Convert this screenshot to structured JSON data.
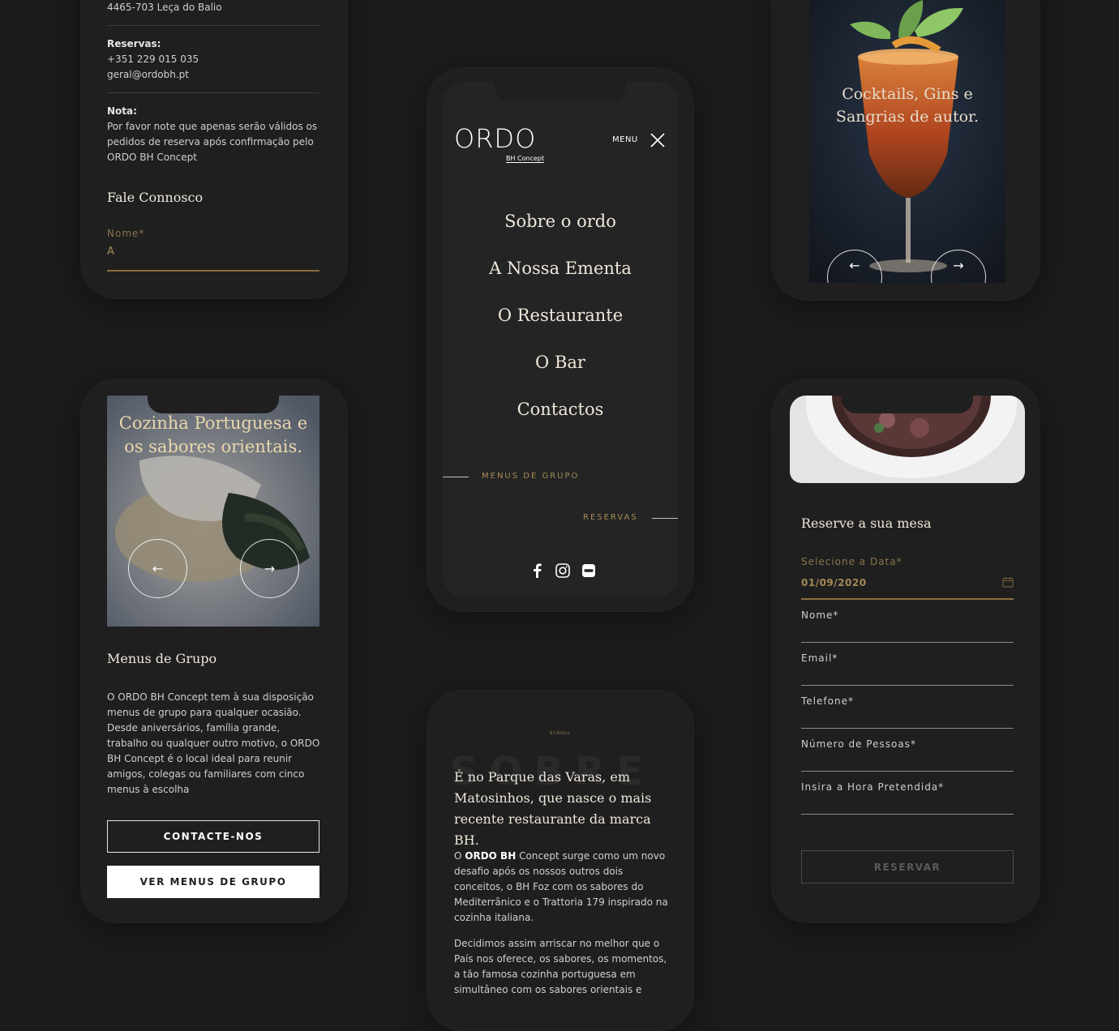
{
  "contact": {
    "address": "4465-703 Leça do Balio",
    "reservas_label": "Reservas:",
    "phone": "+351 229 015 035",
    "email": "geral@ordobh.pt",
    "nota_label": "Nota:",
    "nota_text": "Por favor note que apenas serão válidos os pedidos de reserva após confirmação pelo ORDO BH Concept",
    "form_title": "Fale Connosco",
    "name_label": "Nome*",
    "name_value": "A"
  },
  "menu_screen": {
    "logo": "ORDO",
    "logo_sub": "BH Concept",
    "menu_label": "MENU",
    "nav_items": [
      "Sobre o ordo",
      "A Nossa Ementa",
      "O Restaurante",
      "O Bar",
      "Contactos"
    ],
    "link_group": "MENUS DE GRUPO",
    "link_reservas": "RESERVAS",
    "social_icons": [
      "facebook-icon",
      "instagram-icon",
      "zomato-icon"
    ]
  },
  "cocktails": {
    "headline": "Cocktails, Gins e Sangrias de autor."
  },
  "group_menu": {
    "headline": "Cozinha Portuguesa e os sabores orientais.",
    "title": "Menus de Grupo",
    "text": "O ORDO BH Concept tem à sua disposição menus de grupo para qualquer ocasião. Desde aniversários, família grande, trabalho ou qualquer outro motivo, o ORDO BH Concept é o local ideal para reunir amigos, colegas ou familiares com cinco menus à escolha",
    "btn_contact": "CONTACTE-NOS",
    "btn_menus": "VER MENUS DE GRUPO"
  },
  "about": {
    "scroll_label": "SCROLL",
    "bg_word": "SOBRE",
    "headline": "É no Parque das Varas, em Matosinhos, que nasce o mais recente restaurante da marca BH.",
    "p1_pre": "O ",
    "p1_bold": "ORDO BH",
    "p1_post": " Concept surge como um novo desafio após os nossos outros dois conceitos, o BH Foz com os sabores do Mediterrânico e o Trattoria 179 inspirado na cozinha italiana.",
    "p2": "Decidimos assim arriscar no melhor que o País nos oferece, os sabores, os momentos, a tão famosa cozinha portuguesa em simultâneo com os sabores orientais e"
  },
  "reserve": {
    "title": "Reserve a sua mesa",
    "date_label": "Selecione a Data*",
    "date_value": "01/09/2020",
    "fields": [
      "Nome*",
      "Email*",
      "Telefone*",
      "Número de Pessoas*",
      "Insira a Hora Pretendida*"
    ],
    "submit": "RESERVAR"
  },
  "colors": {
    "background": "#1b1b1b",
    "accent_gold": "#a58a57",
    "text_light": "#efe7db"
  }
}
